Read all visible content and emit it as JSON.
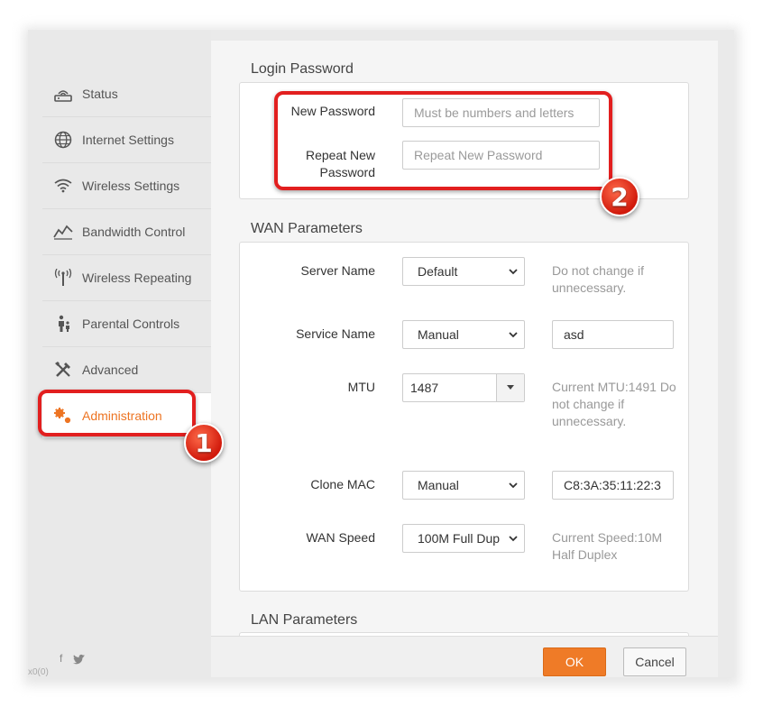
{
  "sidebar": {
    "items": [
      {
        "label": "Status",
        "icon": "router-icon"
      },
      {
        "label": "Internet Settings",
        "icon": "globe-icon"
      },
      {
        "label": "Wireless Settings",
        "icon": "wifi-icon"
      },
      {
        "label": "Bandwidth Control",
        "icon": "chart-line-icon"
      },
      {
        "label": "Wireless Repeating",
        "icon": "antenna-icon"
      },
      {
        "label": "Parental Controls",
        "icon": "family-icon"
      },
      {
        "label": "Advanced",
        "icon": "tools-icon"
      },
      {
        "label": "Administration",
        "icon": "gears-icon"
      }
    ],
    "social": [
      "f",
      "twitter"
    ],
    "corner_text": "x0(0)"
  },
  "login": {
    "title": "Login Password",
    "new_password_label": "New Password",
    "new_password_placeholder": "Must be numbers and letters",
    "repeat_label": "Repeat New Password",
    "repeat_placeholder": "Repeat New Password"
  },
  "wan": {
    "title": "WAN Parameters",
    "server_name_label": "Server Name",
    "server_name_value": "Default",
    "server_name_hint": "Do not change if unnecessary.",
    "service_name_label": "Service Name",
    "service_name_select": "Manual",
    "service_name_value": "asd",
    "mtu_label": "MTU",
    "mtu_value": "1487",
    "mtu_hint": "Current MTU:1491 Do not change if unnecessary.",
    "clone_mac_label": "Clone MAC",
    "clone_mac_select": "Manual",
    "clone_mac_value": "C8:3A:35:11:22:3",
    "wan_speed_label": "WAN Speed",
    "wan_speed_value": "100M Full Dup",
    "wan_speed_hint": "Current Speed:10M Half Duplex"
  },
  "lan": {
    "title": "LAN Parameters"
  },
  "footer": {
    "ok_label": "OK",
    "cancel_label": "Cancel"
  },
  "annotations": {
    "badge_1": "1",
    "badge_2": "2"
  },
  "colors": {
    "accent": "#ef7b27",
    "highlight": "#e21f1f",
    "active_text": "#ed7422"
  }
}
